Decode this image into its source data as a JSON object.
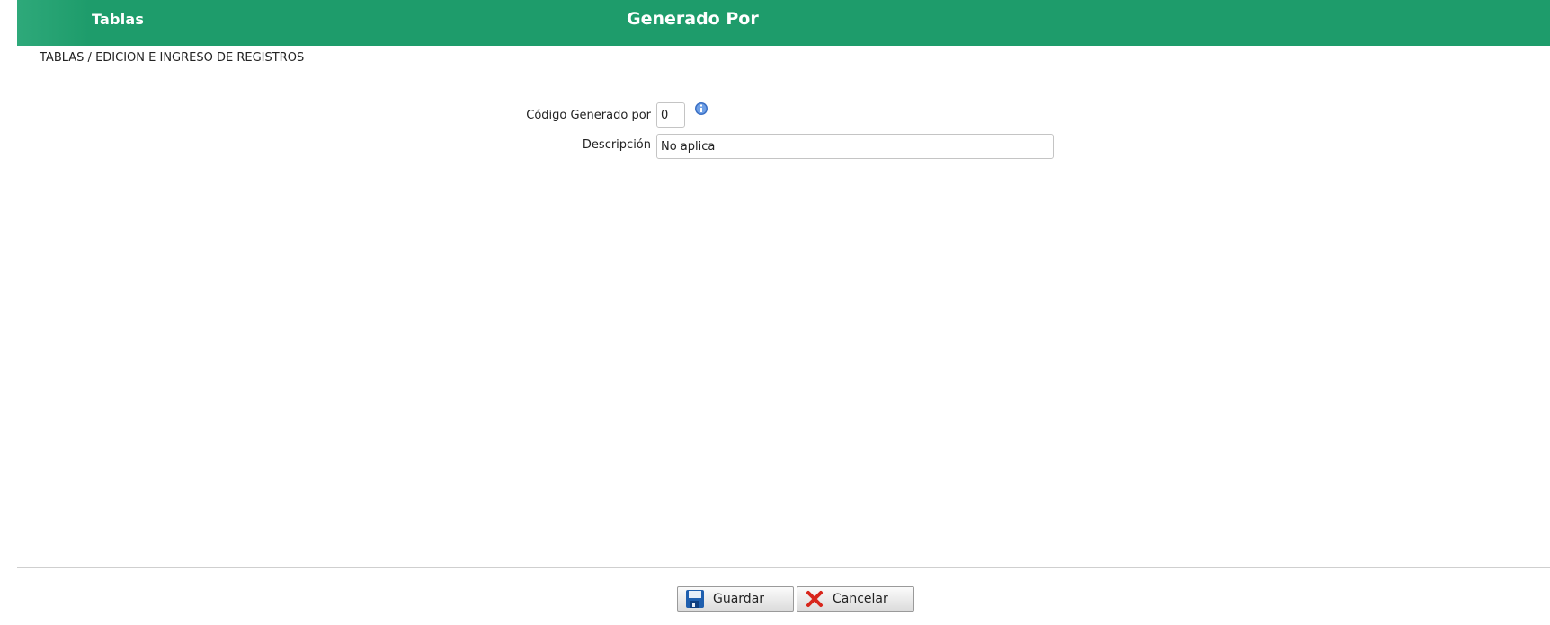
{
  "header": {
    "left_title": "Tablas",
    "center_title": "Generado Por",
    "color": "#1e9c6b"
  },
  "breadcrumb": "TABLAS / EDICION E INGRESO DE REGISTROS",
  "form": {
    "codigo": {
      "label": "Código Generado por",
      "value": "0",
      "icon": "info-icon"
    },
    "descripcion": {
      "label": "Descripción",
      "value": "No aplica"
    }
  },
  "buttons": {
    "guardar": {
      "label": "Guardar",
      "icon": "save-icon"
    },
    "cancelar": {
      "label": "Cancelar",
      "icon": "cancel-icon"
    }
  }
}
